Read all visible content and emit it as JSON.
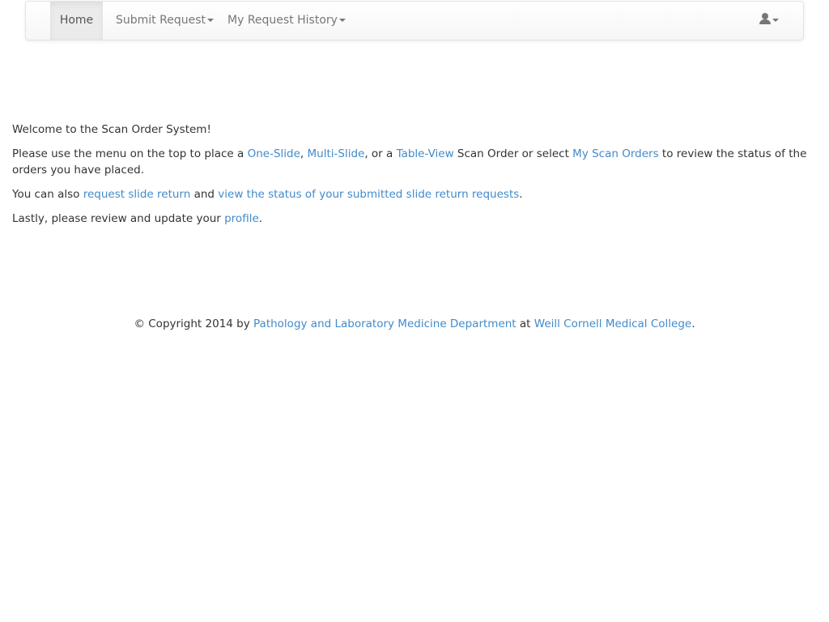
{
  "navbar": {
    "home_label": "Home",
    "submit_label": "Submit Request",
    "history_label": "My Request History",
    "user_icon": "user-icon"
  },
  "main": {
    "welcome": "Welcome to the Scan Order System!",
    "p1": {
      "text1": "Please use the menu on the top to place a ",
      "link_one_slide": "One-Slide",
      "sep1": ", ",
      "link_multi_slide": "Multi-Slide",
      "text2": ", or a ",
      "link_table_view": "Table-View",
      "text3": " Scan Order or select ",
      "link_my_scan_orders": "My Scan Orders",
      "text4": " to review the status of the orders you have placed."
    },
    "p2": {
      "text1": "You can also ",
      "link_request_return": "request slide return",
      "text2": " and ",
      "link_view_status": "view the status of your submitted slide return requests",
      "text3": "."
    },
    "p3": {
      "text1": "Lastly, please review and update your ",
      "link_profile": "profile",
      "text2": "."
    }
  },
  "footer": {
    "text1": "© Copyright 2014 by ",
    "link_department": "Pathology and Laboratory Medicine Department",
    "text2": " at ",
    "link_college": "Weill Cornell Medical College",
    "text3": "."
  },
  "colors": {
    "link": "#428bca",
    "text": "#333333",
    "nav_text": "#777777"
  }
}
